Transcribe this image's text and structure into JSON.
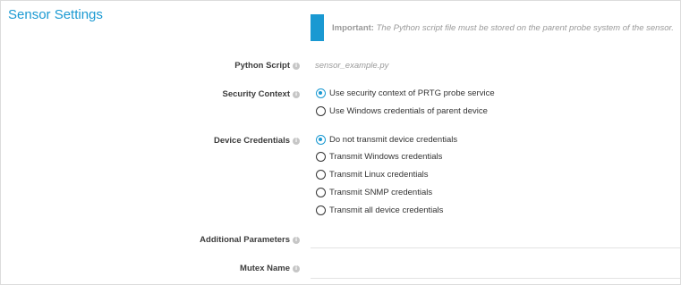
{
  "section": {
    "title": "Sensor Settings"
  },
  "note": {
    "strong": "Important:",
    "body": "The Python script file must be stored on the parent probe system of the sensor."
  },
  "python_script": {
    "label": "Python Script",
    "value": "sensor_example.py"
  },
  "security_context": {
    "label": "Security Context",
    "options": [
      {
        "label": "Use security context of PRTG probe service",
        "checked": true
      },
      {
        "label": "Use Windows credentials of parent device",
        "checked": false
      }
    ]
  },
  "device_credentials": {
    "label": "Device Credentials",
    "options": [
      {
        "label": "Do not transmit device credentials",
        "checked": true
      },
      {
        "label": "Transmit Windows credentials",
        "checked": false
      },
      {
        "label": "Transmit Linux credentials",
        "checked": false
      },
      {
        "label": "Transmit SNMP credentials",
        "checked": false
      },
      {
        "label": "Transmit all device credentials",
        "checked": false
      }
    ]
  },
  "additional_parameters": {
    "label": "Additional Parameters",
    "value": ""
  },
  "mutex_name": {
    "label": "Mutex Name",
    "value": ""
  },
  "info_glyph": "i",
  "colors": {
    "accent": "#1a99d2",
    "label": "#3c3c3c",
    "muted": "#9a9a9a"
  }
}
